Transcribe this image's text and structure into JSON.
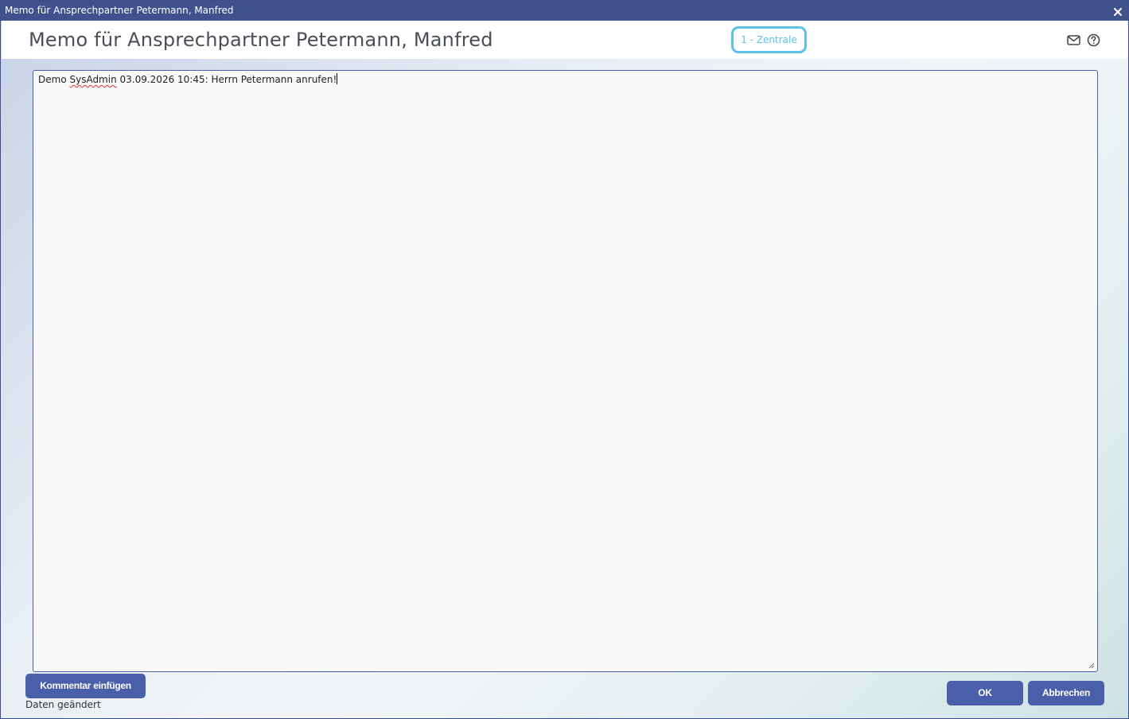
{
  "window": {
    "title": "Memo für Ansprechpartner Petermann, Manfred",
    "close_glyph": "✕"
  },
  "header": {
    "title": "Memo für Ansprechpartner Petermann, Manfred",
    "badge": "1 - Zentrale",
    "icons": [
      "mail-icon",
      "help-icon"
    ]
  },
  "memo": {
    "prefix": "Demo ",
    "misspelled": "SysAdmin",
    "suffix": " 03.09.2026 10:45: Herrn Petermann anrufen!"
  },
  "buttons": {
    "comment_label": "Kommentar einfügen",
    "ok_label": "OK",
    "cancel_label": "Abbrechen"
  },
  "status": {
    "text": "Daten geändert"
  },
  "colors": {
    "titlebar": "#3f528e",
    "button": "#4a5fa9",
    "badge": "#5cc2e8"
  }
}
